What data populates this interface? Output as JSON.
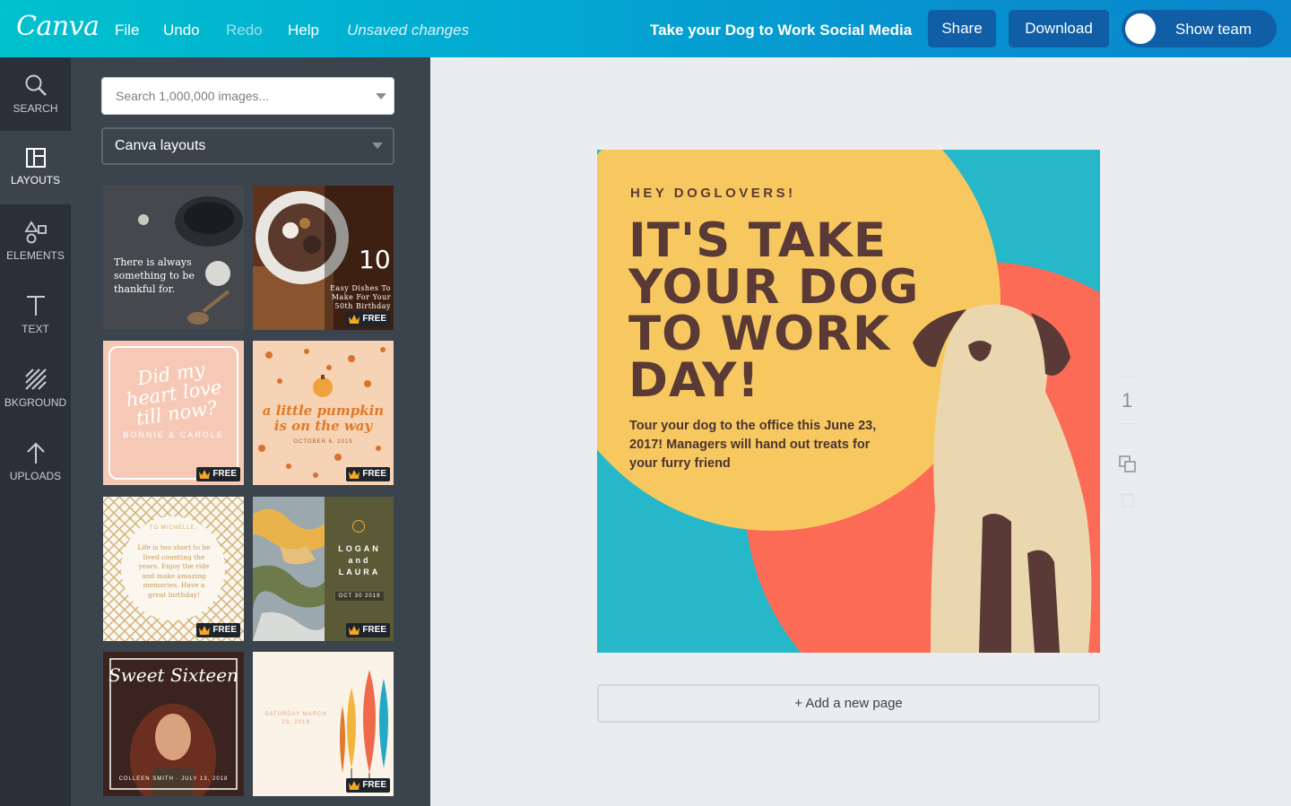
{
  "app": {
    "logo": "Canva"
  },
  "topbar": {
    "menu": [
      "File",
      "Undo",
      "Redo",
      "Help"
    ],
    "status": "Unsaved changes",
    "doc_title": "Take your Dog to Work Social Media",
    "share_label": "Share",
    "download_label": "Download",
    "team_label": "Show team"
  },
  "rail": [
    {
      "label": "SEARCH",
      "icon": "search-icon"
    },
    {
      "label": "LAYOUTS",
      "icon": "layouts-icon"
    },
    {
      "label": "ELEMENTS",
      "icon": "shapes-icon"
    },
    {
      "label": "TEXT",
      "icon": "text-icon"
    },
    {
      "label": "BKGROUND",
      "icon": "background-icon"
    },
    {
      "label": "UPLOADS",
      "icon": "upload-arrow-icon"
    }
  ],
  "panel": {
    "search_placeholder": "Search 1,000,000 images...",
    "filter_value": "Canva layouts",
    "free_label": "FREE",
    "thumbs": {
      "t1_text": "There is always something to be thankful for.",
      "t2_number": "10",
      "t2_text": "Easy Dishes To Make For Your 50th Birthday",
      "t3_script": "Did my heart love till now?",
      "t3_names": "BONNIE & CAROLE",
      "t4_title": "a little pumpkin is on the way",
      "t4_date": "OCTOBER 6, 2019",
      "t5_greeting": "TO MICHELLE,",
      "t5_text": "Life is too short to be lived counting the years. Enjoy the ride and make amazing memories. Have a great birthday!",
      "t6_names": "LOGAN and LAURA",
      "t6_date": "OCT 30 2019",
      "t7_title": "Sweet Sixteen",
      "t7_footer": "COLLEEN SMITH · JULY 13, 2018",
      "t8_date": "SATURDAY MARCH 23, 2019"
    }
  },
  "design": {
    "kicker": "HEY DOGLOVERS!",
    "headline": "IT'S TAKE YOUR DOG TO WORK DAY!",
    "body": "Tour your dog to the office this June 23, 2017! Managers will hand out treats for your furry friend",
    "colors": {
      "teal": "#26b8c9",
      "yellow": "#f8c860",
      "coral": "#fb6b55",
      "brown": "#5a3a36",
      "dog": "#ead7b0"
    }
  },
  "page_controls": {
    "page_number": "1",
    "add_page_label": "+ Add a new page"
  }
}
